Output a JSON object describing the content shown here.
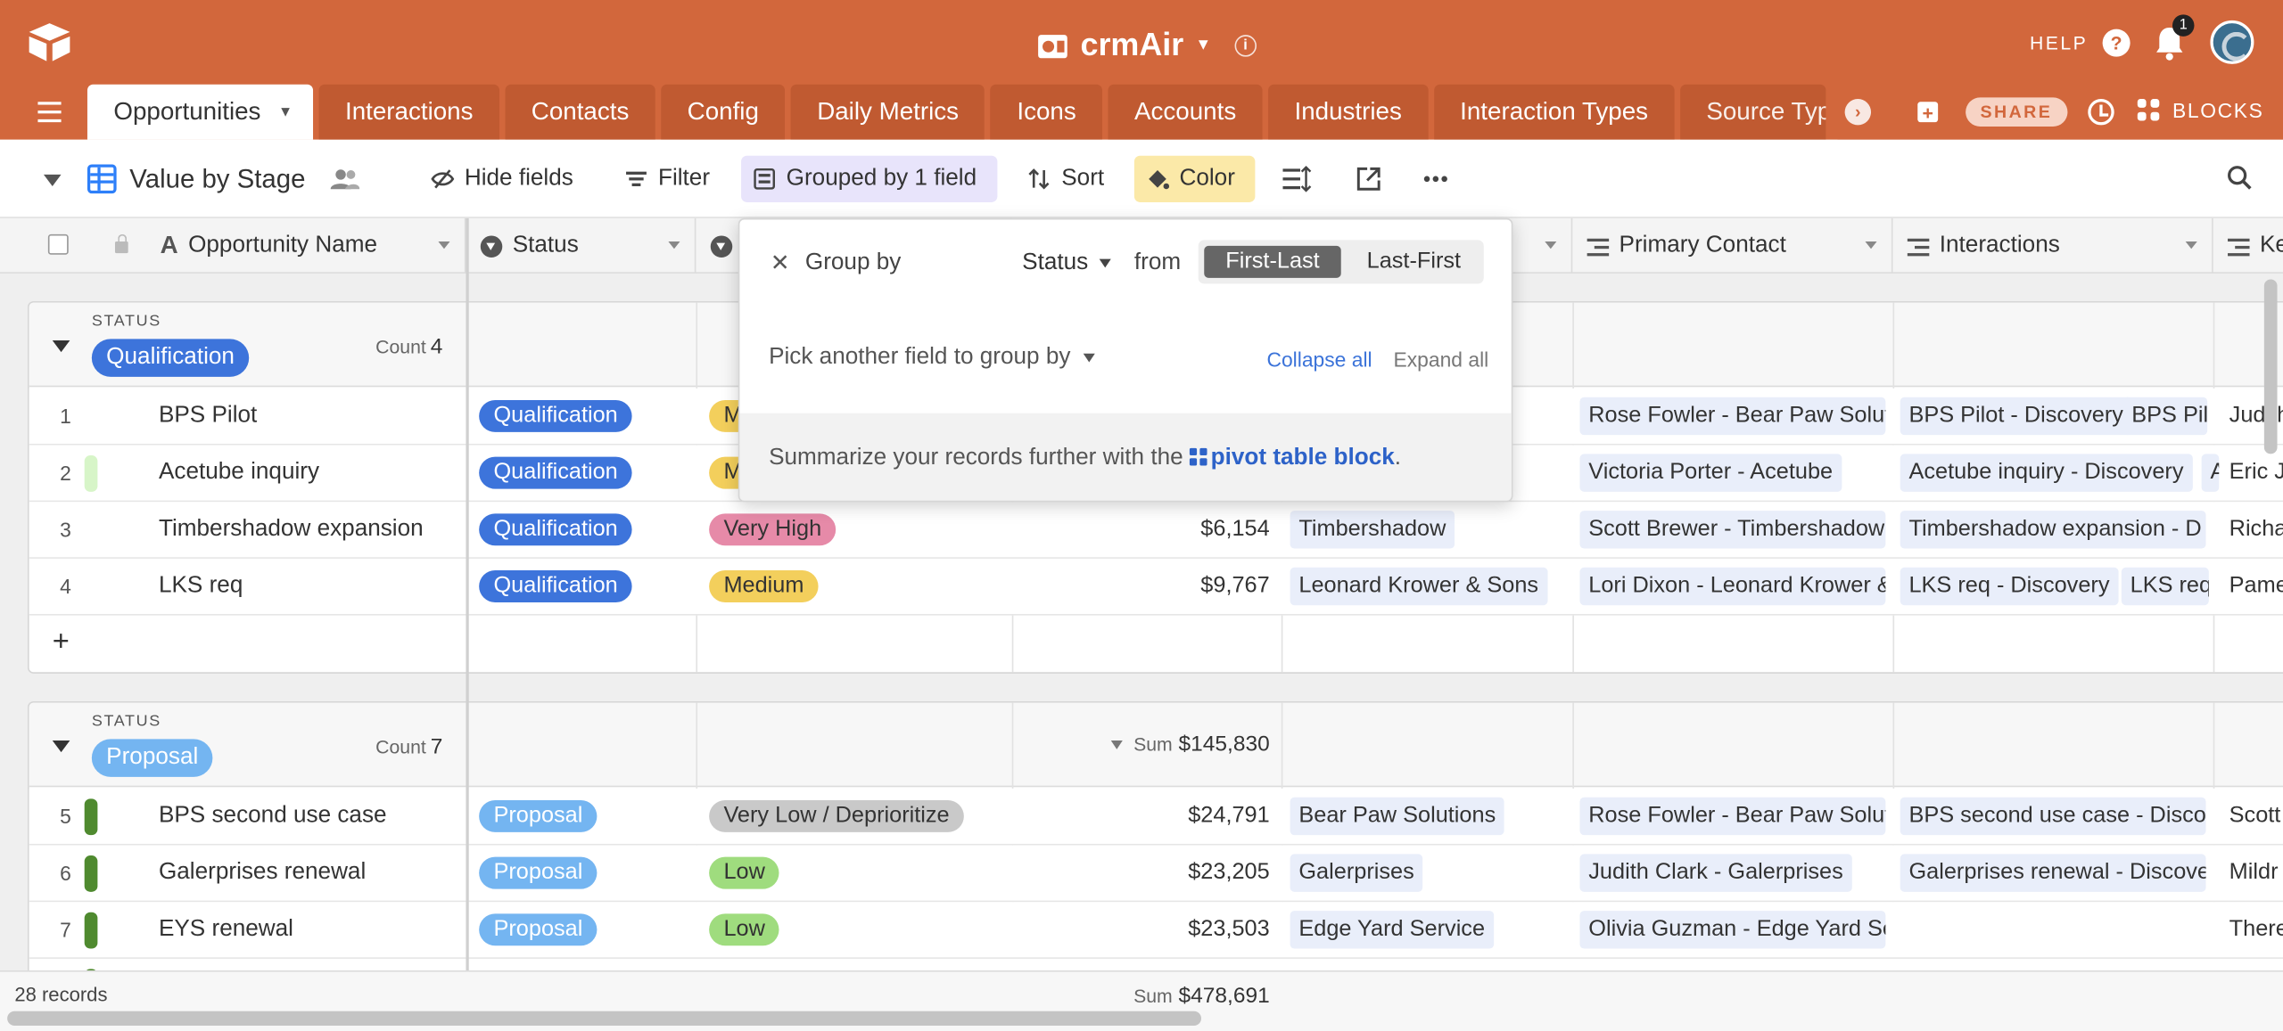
{
  "app": {
    "name": "crmAir",
    "help_label": "HELP",
    "notification_count": "1"
  },
  "tabs": [
    {
      "label": "Opportunities"
    },
    {
      "label": "Interactions"
    },
    {
      "label": "Contacts"
    },
    {
      "label": "Config"
    },
    {
      "label": "Daily Metrics"
    },
    {
      "label": "Icons"
    },
    {
      "label": "Accounts"
    },
    {
      "label": "Industries"
    },
    {
      "label": "Interaction Types"
    },
    {
      "label": "Source Typ"
    }
  ],
  "topbar": {
    "share_label": "SHARE",
    "blocks_label": "BLOCKS"
  },
  "view": {
    "name": "Value by Stage",
    "hide_fields": "Hide fields",
    "filter": "Filter",
    "grouped": "Grouped by 1 field",
    "sort": "Sort",
    "color": "Color"
  },
  "columns": {
    "name": "Opportunity Name",
    "status": "Status",
    "primary_contact": "Primary Contact",
    "interactions": "Interactions",
    "ke": "Ke"
  },
  "popover": {
    "group_by": "Group by",
    "field": "Status",
    "from": "from",
    "first_last": "First-Last",
    "last_first": "Last-First",
    "pick_another": "Pick another field to group by",
    "collapse_all": "Collapse all",
    "expand_all": "Expand all",
    "summary_text": "Summarize your records further with the",
    "pivot_link": "pivot table block",
    "period": "."
  },
  "groups": [
    {
      "label": "STATUS",
      "name": "Qualification",
      "count_label": "Count",
      "count": "4",
      "rows": [
        {
          "num": "1",
          "name": "BPS Pilot",
          "status": "Qualification",
          "priority": "M",
          "amount": "",
          "account": "",
          "contact": "Rose Fowler - Bear Paw Solut",
          "int1": "BPS Pilot - Discovery",
          "int2": "BPS Pil",
          "ke": "Judith"
        },
        {
          "num": "2",
          "name": "Acetube inquiry",
          "status": "Qualification",
          "priority": "M",
          "amount": "",
          "account": "",
          "contact": "Victoria Porter - Acetube",
          "int1": "Acetube inquiry - Discovery",
          "int2": "A",
          "ke": "Eric Ja"
        },
        {
          "num": "3",
          "name": "Timbershadow expansion",
          "status": "Qualification",
          "priority": "Very High",
          "amount": "$6,154",
          "account": "Timbershadow",
          "contact": "Scott Brewer - Timbershadow",
          "int1": "Timbershadow expansion - D",
          "int2": "",
          "ke": "Richa"
        },
        {
          "num": "4",
          "name": "LKS req",
          "status": "Qualification",
          "priority": "Medium",
          "amount": "$9,767",
          "account": "Leonard Krower & Sons",
          "contact": "Lori Dixon - Leonard Krower &",
          "int1": "LKS req - Discovery",
          "int2": "LKS req -",
          "ke": "Pame"
        }
      ]
    },
    {
      "label": "STATUS",
      "name": "Proposal",
      "count_label": "Count",
      "count": "7",
      "sum_label": "Sum",
      "sum": "$145,830",
      "rows": [
        {
          "num": "5",
          "name": "BPS second use case",
          "status": "Proposal",
          "priority": "Very Low / Deprioritize",
          "amount": "$24,791",
          "account": "Bear Paw Solutions",
          "contact": "Rose Fowler - Bear Paw Solut",
          "int1": "BPS second use case - Discov",
          "int2": "",
          "ke": "Scott"
        },
        {
          "num": "6",
          "name": "Galerprises renewal",
          "status": "Proposal",
          "priority": "Low",
          "amount": "$23,205",
          "account": "Galerprises",
          "contact": "Judith Clark - Galerprises",
          "int1": "Galerprises renewal - Discove",
          "int2": "",
          "ke": "Mildr"
        },
        {
          "num": "7",
          "name": "EYS renewal",
          "status": "Proposal",
          "priority": "Low",
          "amount": "$23,503",
          "account": "Edge Yard Service",
          "contact": "Olivia Guzman - Edge Yard Se",
          "int1": "",
          "int2": "",
          "ke": "There"
        }
      ]
    }
  ],
  "add_row": "+",
  "footer": {
    "records": "28 records",
    "sum_label": "Sum",
    "sum": "$478,691"
  },
  "colors": {
    "brand": "#d2673c",
    "qualification": "#3d74db",
    "proposal": "#74b5f1",
    "very_high": "#e68aa8",
    "medium": "#f3cf5c",
    "low": "#9fdc7e",
    "very_low": "#c9c9c9"
  },
  "icons": [
    "logo-icon",
    "info-icon",
    "help-icon",
    "bell-icon",
    "avatar",
    "menu-icon",
    "add-table-icon",
    "history-icon",
    "blocks-icon",
    "grid-view-icon",
    "people-icon",
    "hide-fields-icon",
    "filter-icon",
    "group-icon",
    "sort-icon",
    "color-icon",
    "row-height-icon",
    "share-view-icon",
    "more-icon",
    "search-icon",
    "lock-icon"
  ]
}
